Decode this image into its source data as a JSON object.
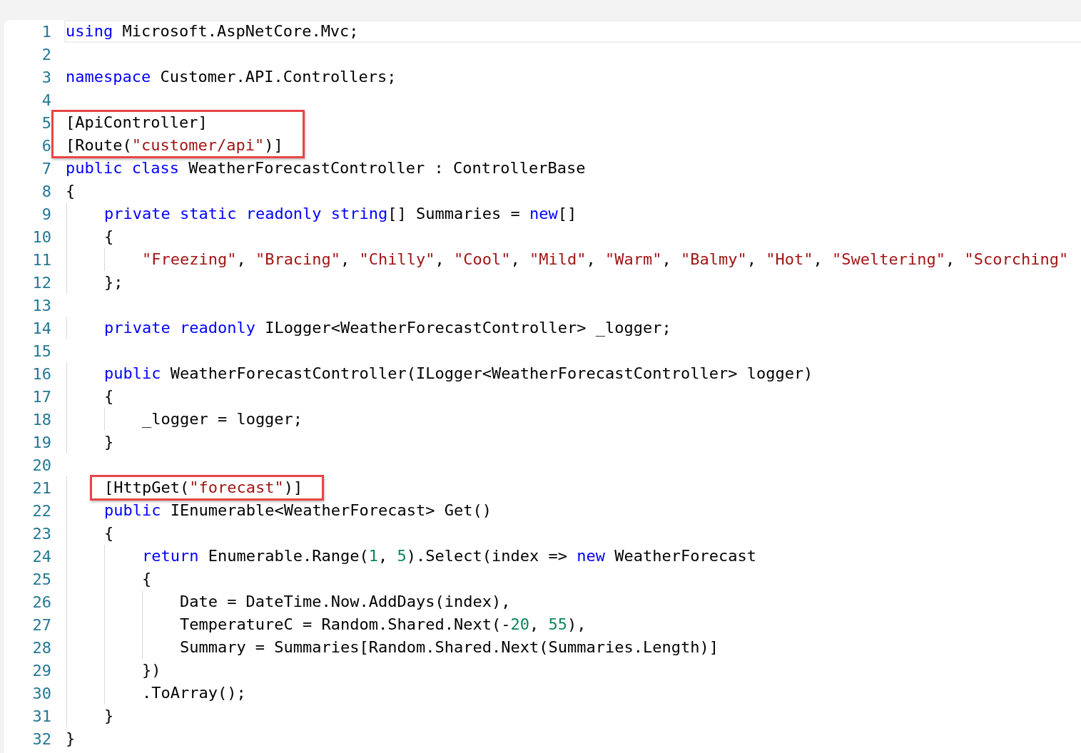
{
  "editor": {
    "lines": [
      {
        "number": "1",
        "current": true,
        "boxed": false,
        "tokens": [
          {
            "kind": "keyword",
            "text": "using"
          },
          {
            "kind": "plain",
            "text": " Microsoft.AspNetCore.Mvc;"
          }
        ]
      },
      {
        "number": "2",
        "current": false,
        "boxed": false
      },
      {
        "number": "3",
        "current": false,
        "boxed": false,
        "tokens": [
          {
            "kind": "keyword",
            "text": "namespace"
          },
          {
            "kind": "plain",
            "text": " Customer.API.Controllers;"
          }
        ]
      },
      {
        "number": "4",
        "current": false,
        "boxed": false
      },
      {
        "number": "5",
        "current": false,
        "boxed": true,
        "tokens": [
          {
            "kind": "plain",
            "text": "[ApiController]"
          }
        ]
      },
      {
        "number": "6",
        "current": false,
        "boxed": true,
        "tokens": [
          {
            "kind": "plain",
            "text": "[Route("
          },
          {
            "kind": "string",
            "text": "\"customer/api\""
          },
          {
            "kind": "plain",
            "text": ")]"
          }
        ]
      },
      {
        "number": "7",
        "current": false,
        "boxed": false,
        "tokens": [
          {
            "kind": "keyword",
            "text": "public class"
          },
          {
            "kind": "plain",
            "text": " WeatherForecastController : ControllerBase"
          }
        ]
      },
      {
        "number": "8",
        "current": false,
        "boxed": false,
        "tokens": [
          {
            "kind": "plain",
            "text": "{"
          }
        ]
      },
      {
        "number": "9",
        "current": false,
        "boxed": false,
        "tokens": [
          {
            "kind": "keyword",
            "text": "    private static readonly string"
          },
          {
            "kind": "plain",
            "text": "[] Summaries = "
          },
          {
            "kind": "keyword",
            "text": "new"
          },
          {
            "kind": "plain",
            "text": "[]"
          }
        ]
      },
      {
        "number": "10",
        "current": false,
        "boxed": false,
        "tokens": [
          {
            "kind": "plain",
            "text": "    {"
          }
        ]
      },
      {
        "number": "11",
        "current": false,
        "boxed": false,
        "tokens": [
          {
            "kind": "string",
            "text": "        \"Freezing\""
          },
          {
            "kind": "plain",
            "text": ", "
          },
          {
            "kind": "string",
            "text": "\"Bracing\""
          },
          {
            "kind": "plain",
            "text": ", "
          },
          {
            "kind": "string",
            "text": "\"Chilly\""
          },
          {
            "kind": "plain",
            "text": ", "
          },
          {
            "kind": "string",
            "text": "\"Cool\""
          },
          {
            "kind": "plain",
            "text": ", "
          },
          {
            "kind": "string",
            "text": "\"Mild\""
          },
          {
            "kind": "plain",
            "text": ", "
          },
          {
            "kind": "string",
            "text": "\"Warm\""
          },
          {
            "kind": "plain",
            "text": ", "
          },
          {
            "kind": "string",
            "text": "\"Balmy\""
          },
          {
            "kind": "plain",
            "text": ", "
          },
          {
            "kind": "string",
            "text": "\"Hot\""
          },
          {
            "kind": "plain",
            "text": ", "
          },
          {
            "kind": "string",
            "text": "\"Sweltering\""
          },
          {
            "kind": "plain",
            "text": ", "
          },
          {
            "kind": "string",
            "text": "\"Scorching\""
          }
        ]
      },
      {
        "number": "12",
        "current": false,
        "boxed": false,
        "tokens": [
          {
            "kind": "plain",
            "text": "    };"
          }
        ]
      },
      {
        "number": "13",
        "current": false,
        "boxed": false
      },
      {
        "number": "14",
        "current": false,
        "boxed": false,
        "tokens": [
          {
            "kind": "keyword",
            "text": "    private readonly"
          },
          {
            "kind": "plain",
            "text": " ILogger<WeatherForecastController> _logger;"
          }
        ]
      },
      {
        "number": "15",
        "current": false,
        "boxed": false
      },
      {
        "number": "16",
        "current": false,
        "boxed": false,
        "tokens": [
          {
            "kind": "keyword",
            "text": "    public"
          },
          {
            "kind": "plain",
            "text": " WeatherForecastController(ILogger<WeatherForecastController> logger)"
          }
        ]
      },
      {
        "number": "17",
        "current": false,
        "boxed": false,
        "tokens": [
          {
            "kind": "plain",
            "text": "    {"
          }
        ]
      },
      {
        "number": "18",
        "current": false,
        "boxed": false,
        "tokens": [
          {
            "kind": "plain",
            "text": "        _logger = logger;"
          }
        ]
      },
      {
        "number": "19",
        "current": false,
        "boxed": false,
        "tokens": [
          {
            "kind": "plain",
            "text": "    }"
          }
        ]
      },
      {
        "number": "20",
        "current": false,
        "boxed": false
      },
      {
        "number": "21",
        "current": false,
        "boxed": true,
        "tokens": [
          {
            "kind": "plain",
            "text": "    [HttpGet("
          },
          {
            "kind": "string",
            "text": "\"forecast\""
          },
          {
            "kind": "plain",
            "text": ")]"
          }
        ]
      },
      {
        "number": "22",
        "current": false,
        "boxed": false,
        "tokens": [
          {
            "kind": "keyword",
            "text": "    public"
          },
          {
            "kind": "plain",
            "text": " IEnumerable<WeatherForecast> Get()"
          }
        ]
      },
      {
        "number": "23",
        "current": false,
        "boxed": false,
        "tokens": [
          {
            "kind": "plain",
            "text": "    {"
          }
        ]
      },
      {
        "number": "24",
        "current": false,
        "boxed": false,
        "tokens": [
          {
            "kind": "keyword",
            "text": "        return"
          },
          {
            "kind": "plain",
            "text": " Enumerable.Range("
          },
          {
            "kind": "number",
            "text": "1"
          },
          {
            "kind": "plain",
            "text": ", "
          },
          {
            "kind": "number",
            "text": "5"
          },
          {
            "kind": "plain",
            "text": ").Select(index => "
          },
          {
            "kind": "keyword",
            "text": "new"
          },
          {
            "kind": "plain",
            "text": " WeatherForecast"
          }
        ]
      },
      {
        "number": "25",
        "current": false,
        "boxed": false,
        "tokens": [
          {
            "kind": "plain",
            "text": "        {"
          }
        ]
      },
      {
        "number": "26",
        "current": false,
        "boxed": false,
        "tokens": [
          {
            "kind": "plain",
            "text": "            Date = DateTime.Now.AddDays(index),"
          }
        ]
      },
      {
        "number": "27",
        "current": false,
        "boxed": false,
        "tokens": [
          {
            "kind": "plain",
            "text": "            TemperatureC = Random.Shared.Next(-"
          },
          {
            "kind": "number",
            "text": "20"
          },
          {
            "kind": "plain",
            "text": ", "
          },
          {
            "kind": "number",
            "text": "55"
          },
          {
            "kind": "plain",
            "text": "),"
          }
        ]
      },
      {
        "number": "28",
        "current": false,
        "boxed": false,
        "tokens": [
          {
            "kind": "plain",
            "text": "            Summary = Summaries[Random.Shared.Next(Summaries.Length)]"
          }
        ]
      },
      {
        "number": "29",
        "current": false,
        "boxed": false,
        "tokens": [
          {
            "kind": "plain",
            "text": "        })"
          }
        ]
      },
      {
        "number": "30",
        "current": false,
        "boxed": false,
        "tokens": [
          {
            "kind": "plain",
            "text": "        .ToArray();"
          }
        ]
      },
      {
        "number": "31",
        "current": false,
        "boxed": false,
        "tokens": [
          {
            "kind": "plain",
            "text": "    }"
          }
        ]
      },
      {
        "number": "32",
        "current": false,
        "boxed": false,
        "tokens": [
          {
            "kind": "plain",
            "text": "}"
          }
        ]
      }
    ]
  }
}
